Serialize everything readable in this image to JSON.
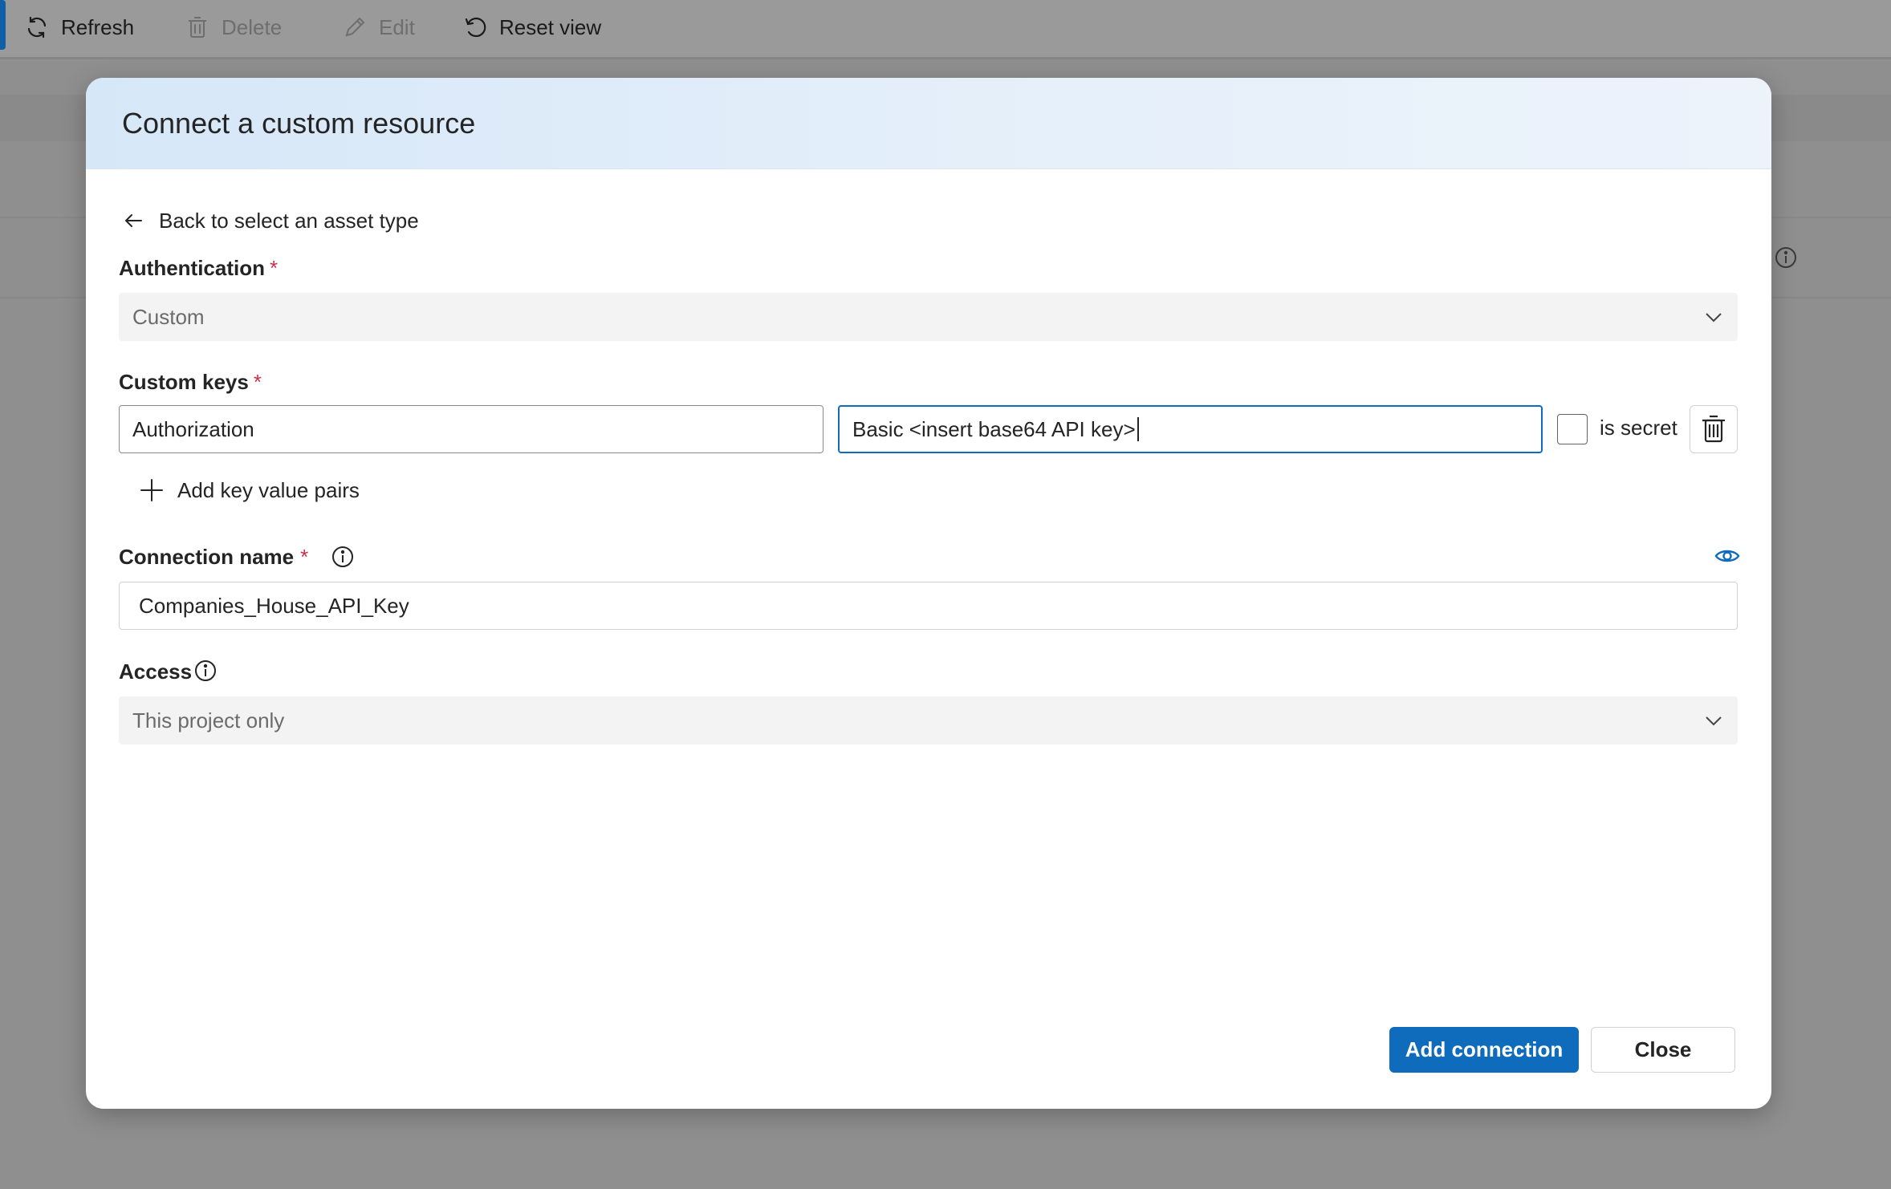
{
  "toolbar": {
    "refresh_label": "Refresh",
    "delete_label": "Delete",
    "edit_label": "Edit",
    "reset_view_label": "Reset view"
  },
  "dialog": {
    "title": "Connect a custom resource",
    "back_link": "Back to select an asset type",
    "authentication": {
      "label": "Authentication",
      "required_mark": "*",
      "selected_value": "Custom"
    },
    "custom_keys": {
      "label": "Custom keys",
      "required_mark": "*",
      "key_value": "Authorization",
      "value_value": "Basic <insert base64 API key>",
      "is_secret_label": "is secret",
      "is_secret_checked": false,
      "add_pairs_label": "Add key value pairs"
    },
    "connection_name": {
      "label": "Connection name",
      "required_mark": "*",
      "value": "Companies_House_API_Key"
    },
    "access": {
      "label": "Access",
      "selected_value": "This project only"
    },
    "buttons": {
      "add_connection": "Add connection",
      "close": "Close"
    }
  },
  "colors": {
    "primary": "#0f6cbd",
    "required": "#c4314b",
    "header_gradient_start": "#d6e7f8"
  },
  "icons": {
    "refresh": "refresh-icon",
    "delete": "trash-icon",
    "edit": "pencil-icon",
    "reset": "reset-icon",
    "back": "arrow-left-icon",
    "info": "info-icon",
    "eye": "eye-icon",
    "add": "plus-icon",
    "chevron": "chevron-down-icon"
  }
}
